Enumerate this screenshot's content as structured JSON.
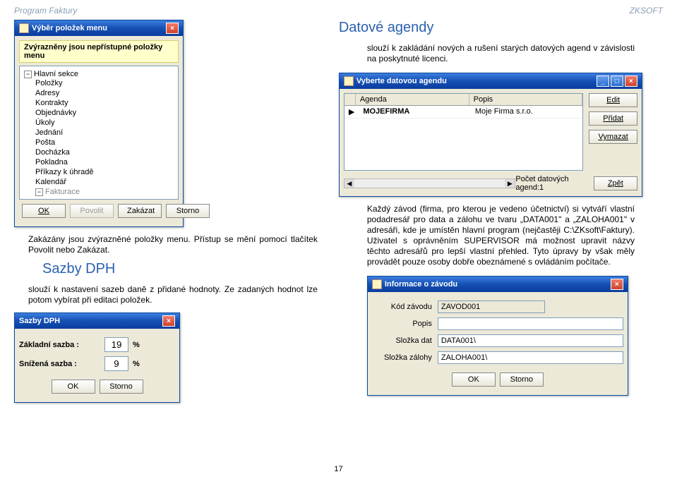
{
  "header": {
    "left": "Program Faktury",
    "right": "ZKSOFT"
  },
  "menu_win": {
    "title": "Výběr položek menu",
    "hint": "Zvýrazněny jsou nepřístupné položky menu",
    "root": "Hlavní sekce",
    "items": [
      "Položky",
      "Adresy",
      "Kontrakty",
      "Objednávky",
      "Úkoly",
      "Jednání",
      "Pošta",
      "Docházka",
      "Pokladna",
      "Příkazy k úhradě",
      "Kalendář"
    ],
    "sub": "Fakturace",
    "buttons": {
      "ok": "OK",
      "povolit": "Povolit",
      "zakazat": "Zakázat",
      "storno": "Storno"
    }
  },
  "texts": {
    "zak_line": "Zakázány jsou zvýrazněné položky menu. Přístup se mění pomocí tlačítek Povolit nebo Zakázat.",
    "sazby_title": "Sazby DPH",
    "sazby_desc": "slouží k nastavení sazeb daně z přidané hodnoty. Ze zadaných hodnot lze potom vybírat při editaci položek.",
    "agendy_title": "Datové agendy",
    "agendy_desc": "slouží k zakládání nových a rušení starých datových agend v závislosti na poskytnuté licenci.",
    "zavod_desc": "Každý závod (firma, pro kterou je vedeno účetnictví) si vytváří vlastní podadresář pro data a zálohu ve tvaru „DATA001\" a „ZALOHA001\" v adresáři, kde je umístěn hlavní program (nejčastěji C:\\ZKsoft\\Faktury). Uživatel s oprávněním SUPERVISOR má možnost upravit názvy těchto adresářů pro lepší vlastní přehled. Tyto úpravy by však měly provádět pouze osoby dobře obeznámené s ovládáním počítače."
  },
  "sazby_dlg": {
    "title": "Sazby DPH",
    "zakl_label": "Základní sazba :",
    "zakl_val": "19",
    "sniz_label": "Snížená sazba :",
    "sniz_val": "9",
    "pct": "%",
    "ok": "OK",
    "storno": "Storno"
  },
  "agenda_win": {
    "title": "Vyberte datovou agendu",
    "h_agenda": "Agenda",
    "h_popis": "Popis",
    "row_agenda": "MOJEFIRMA",
    "row_popis": "Moje Firma s.r.o.",
    "edit": "Edit",
    "pridat": "Přidat",
    "vymazat": "Vymazat",
    "zpet": "Zpět",
    "count": "Počet datových agend:1"
  },
  "zavod_win": {
    "title": "Informace o závodu",
    "l_kod": "Kód závodu",
    "v_kod": "ZAVOD001",
    "l_popis": "Popis",
    "v_popis": "",
    "l_dat": "Složka dat",
    "v_dat": "DATA001\\",
    "l_zal": "Složka zálohy",
    "v_zal": "ZALOHA001\\",
    "ok": "OK",
    "storno": "Storno"
  },
  "pagenum": "17"
}
